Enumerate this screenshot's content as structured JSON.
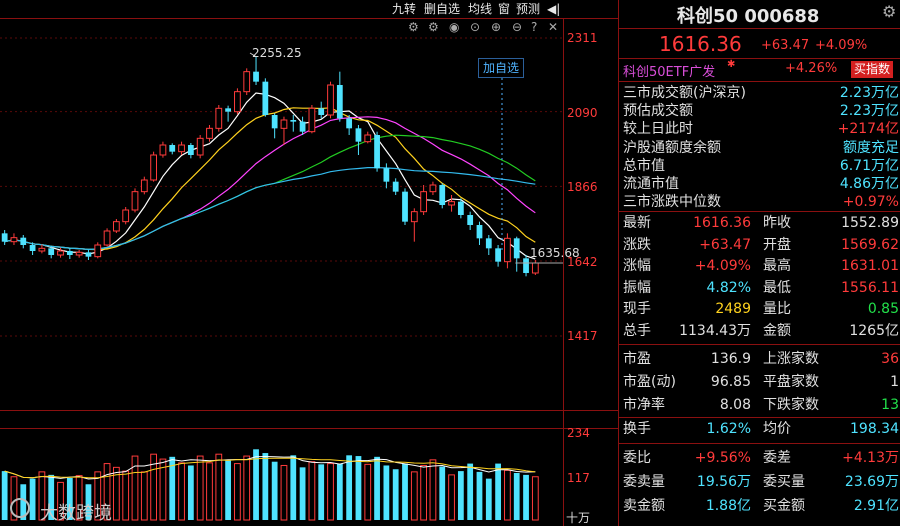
{
  "toolbar": {
    "items": [
      "九转",
      "删自选",
      "均线",
      "窗",
      "预测"
    ],
    "more_label": "◀|"
  },
  "chart": {
    "price_axis": [
      "2311",
      "2090",
      "1866",
      "1642",
      "1417"
    ],
    "volume_axis": [
      "234",
      "117",
      "十万"
    ],
    "high_label": "2255.25",
    "last_label": "1635.68",
    "add_watch_label": "加自选",
    "watermark": "大数跨境"
  },
  "chart_data": {
    "type": "candlestick",
    "ylim": [
      1417,
      2311
    ],
    "candles": [
      [
        1725,
        1700,
        1735,
        1690
      ],
      [
        1700,
        1712,
        1725,
        1690
      ],
      [
        1712,
        1690,
        1720,
        1680
      ],
      [
        1690,
        1672,
        1698,
        1660
      ],
      [
        1672,
        1680,
        1692,
        1665
      ],
      [
        1680,
        1660,
        1688,
        1650
      ],
      [
        1660,
        1672,
        1682,
        1652
      ],
      [
        1672,
        1660,
        1680,
        1648
      ],
      [
        1660,
        1668,
        1675,
        1652
      ],
      [
        1668,
        1655,
        1675,
        1645
      ],
      [
        1655,
        1690,
        1698,
        1650
      ],
      [
        1690,
        1732,
        1740,
        1685
      ],
      [
        1732,
        1760,
        1768,
        1726
      ],
      [
        1760,
        1795,
        1804,
        1752
      ],
      [
        1795,
        1850,
        1860,
        1788
      ],
      [
        1850,
        1885,
        1895,
        1842
      ],
      [
        1885,
        1960,
        1970,
        1880
      ],
      [
        1960,
        1990,
        2000,
        1952
      ],
      [
        1990,
        1970,
        1995,
        1962
      ],
      [
        1970,
        1990,
        2000,
        1960
      ],
      [
        1990,
        1960,
        1996,
        1950
      ],
      [
        1960,
        2010,
        2020,
        1950
      ],
      [
        2010,
        2040,
        2050,
        2000
      ],
      [
        2040,
        2100,
        2110,
        2030
      ],
      [
        2100,
        2090,
        2108,
        2060
      ],
      [
        2090,
        2150,
        2160,
        2082
      ],
      [
        2150,
        2210,
        2220,
        2140
      ],
      [
        2210,
        2180,
        2255,
        2170
      ],
      [
        2180,
        2080,
        2190,
        2075
      ],
      [
        2080,
        2040,
        2085,
        2010
      ],
      [
        2040,
        2065,
        2075,
        1990
      ],
      [
        2065,
        2060,
        2080,
        2030
      ],
      [
        2060,
        2030,
        2075,
        2020
      ],
      [
        2030,
        2100,
        2110,
        2025
      ],
      [
        2100,
        2080,
        2120,
        2070
      ],
      [
        2080,
        2170,
        2180,
        2070
      ],
      [
        2170,
        2070,
        2210,
        2060
      ],
      [
        2070,
        2040,
        2080,
        2020
      ],
      [
        2040,
        2000,
        2050,
        1960
      ],
      [
        2000,
        2020,
        2030,
        1995
      ],
      [
        2020,
        1920,
        2030,
        1910
      ],
      [
        1920,
        1880,
        1935,
        1860
      ],
      [
        1880,
        1850,
        1890,
        1840
      ],
      [
        1850,
        1760,
        1860,
        1750
      ],
      [
        1760,
        1790,
        1800,
        1700
      ],
      [
        1790,
        1850,
        1870,
        1780
      ],
      [
        1850,
        1870,
        1880,
        1840
      ],
      [
        1870,
        1810,
        1875,
        1800
      ],
      [
        1810,
        1820,
        1840,
        1790
      ],
      [
        1820,
        1780,
        1830,
        1770
      ],
      [
        1780,
        1750,
        1790,
        1735
      ],
      [
        1750,
        1710,
        1760,
        1690
      ],
      [
        1710,
        1680,
        1720,
        1660
      ],
      [
        1680,
        1640,
        1690,
        1625
      ],
      [
        1640,
        1710,
        1725,
        1620
      ],
      [
        1710,
        1650,
        1715,
        1610
      ],
      [
        1650,
        1606,
        1660,
        1596
      ],
      [
        1606,
        1636,
        1645,
        1600
      ]
    ],
    "ma_lines": [
      {
        "name": "MA5",
        "color": "#ffffff"
      },
      {
        "name": "MA10",
        "color": "#ffd21e"
      },
      {
        "name": "MA20",
        "color": "#ff44ff"
      },
      {
        "name": "MA30",
        "color": "#22cc22"
      },
      {
        "name": "MA60",
        "color": "#33bbee"
      }
    ],
    "volume_max": 234,
    "volumes": [
      130,
      115,
      95,
      110,
      128,
      120,
      100,
      112,
      118,
      95,
      128,
      150,
      140,
      130,
      170,
      128,
      175,
      162,
      168,
      152,
      145,
      170,
      152,
      175,
      158,
      150,
      170,
      188,
      178,
      155,
      145,
      172,
      140,
      155,
      148,
      150,
      150,
      172,
      170,
      148,
      168,
      145,
      135,
      150,
      128,
      145,
      160,
      142,
      120,
      130,
      150,
      128,
      110,
      150,
      132,
      125,
      120,
      115
    ]
  },
  "panel": {
    "title": "科创50 000688",
    "price": "1616.36",
    "change": "+63.47",
    "change_pct": "+4.09%",
    "etf_name": "科创50ETF广发",
    "etf_pct": "+4.26%",
    "etf_button": "买指数",
    "market_rows": [
      {
        "label": "三市成交额(沪深京)",
        "value": "2.23万亿",
        "color": "cyan"
      },
      {
        "label": "预估成交额",
        "value": "2.23万亿",
        "color": "cyan"
      },
      {
        "label": "较上日此时",
        "value": "+2174亿",
        "color": "red"
      },
      {
        "label": "沪股通额度余额",
        "value": "额度充足",
        "color": "cyan"
      },
      {
        "label": "总市值",
        "value": "6.71万亿",
        "color": "cyan"
      },
      {
        "label": "流通市值",
        "value": "4.86万亿",
        "color": "cyan"
      },
      {
        "label": "三市涨跌中位数",
        "value": "+0.97%",
        "color": "red"
      }
    ],
    "quote_rows": [
      {
        "l1": "最新",
        "v1": "1616.36",
        "c1": "red",
        "l2": "昨收",
        "v2": "1552.89",
        "c2": ""
      },
      {
        "l1": "涨跌",
        "v1": "+63.47",
        "c1": "red",
        "l2": "开盘",
        "v2": "1569.62",
        "c2": "red"
      },
      {
        "l1": "涨幅",
        "v1": "+4.09%",
        "c1": "red",
        "l2": "最高",
        "v2": "1631.01",
        "c2": "red"
      },
      {
        "l1": "振幅",
        "v1": "4.82%",
        "c1": "cyan",
        "l2": "最低",
        "v2": "1556.11",
        "c2": "red"
      },
      {
        "l1": "现手",
        "v1": "2489",
        "c1": "yellow",
        "l2": "量比",
        "v2": "0.85",
        "c2": "green"
      },
      {
        "l1": "总手",
        "v1": "1134.43万",
        "c1": "",
        "l2": "金额",
        "v2": "1265亿",
        "c2": ""
      }
    ],
    "stat_rows": [
      {
        "l1": "市盈",
        "v1": "136.9",
        "l2": "上涨家数",
        "v2": "36",
        "c2": "red"
      },
      {
        "l1": "市盈(动)",
        "v1": "96.85",
        "l2": "平盘家数",
        "v2": "1",
        "c2": ""
      },
      {
        "l1": "市净率",
        "v1": "8.08",
        "l2": "下跌家数",
        "v2": "13",
        "c2": "green"
      }
    ],
    "turnover": {
      "l1": "换手",
      "v1": "1.62%",
      "l2": "均价",
      "v2": "198.34"
    },
    "order_rows": [
      {
        "l1": "委比",
        "v1": "+9.56%",
        "c1": "red",
        "l2": "委差",
        "v2": "+4.13万",
        "c2": "red"
      },
      {
        "l1": "委卖量",
        "v1": "19.56万",
        "c1": "cyan",
        "l2": "委买量",
        "v2": "23.69万",
        "c2": "cyan"
      },
      {
        "l1": "卖金额",
        "v1": "1.88亿",
        "c1": "cyan",
        "l2": "买金额",
        "v2": "2.91亿",
        "c2": "cyan"
      }
    ]
  }
}
